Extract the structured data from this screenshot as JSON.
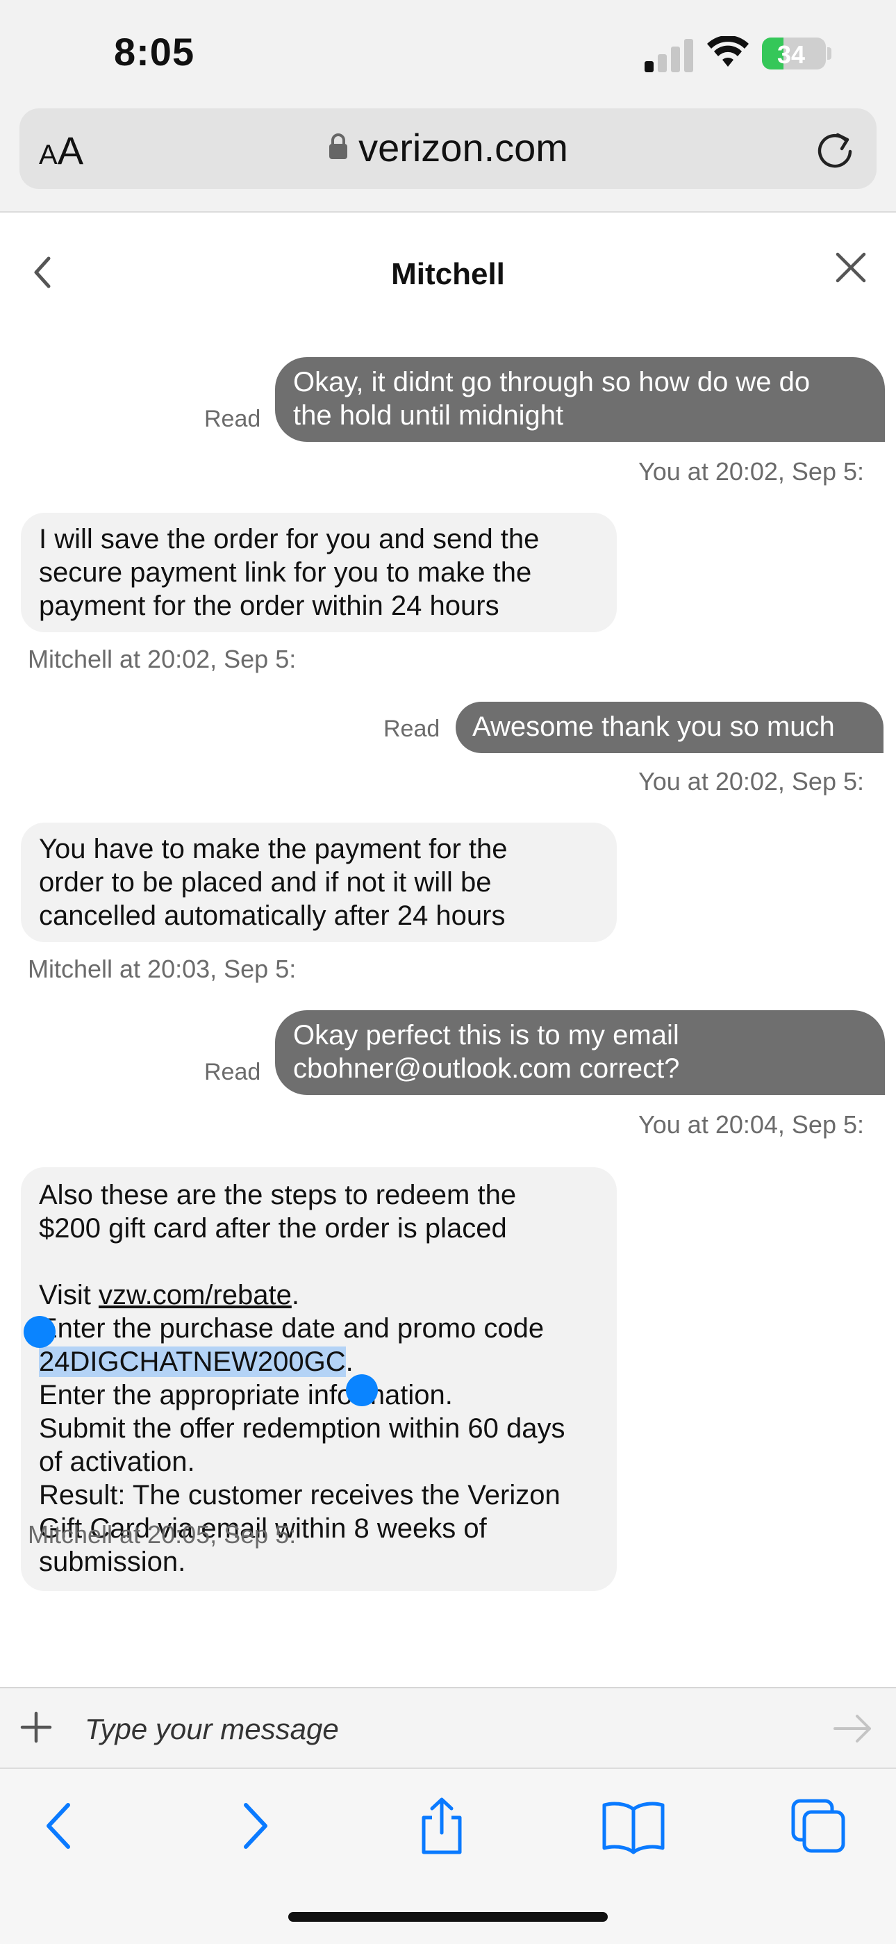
{
  "status_bar": {
    "time": "8:05",
    "battery_percent": "34",
    "battery_level": 0.34,
    "battery_color": "#35c759",
    "signal_bars": 1,
    "icons": [
      "signal-icon",
      "wifi-icon",
      "battery-charging-icon"
    ]
  },
  "url_bar": {
    "reader_label_small": "A",
    "reader_label_large": "A",
    "domain": "verizon.com",
    "icons": [
      "lock-icon",
      "reload-icon"
    ]
  },
  "chat": {
    "title": "Mitchell",
    "icons": [
      "back-icon",
      "close-icon"
    ],
    "messages": [
      {
        "from": "You",
        "text_lines": [
          "Okay, it didnt go through so how do we do",
          "the hold until midnight"
        ],
        "read": "Read",
        "meta": "You at 20:02, Sep 5:"
      },
      {
        "from": "Mitchell",
        "text_lines": [
          "I will save the order for you and send the",
          "secure payment link for you to make the",
          "payment for the order within 24 hours"
        ],
        "meta": "Mitchell at 20:02, Sep 5:"
      },
      {
        "from": "You",
        "text_lines": [
          "Awesome thank you so much"
        ],
        "read": "Read",
        "meta": "You at 20:02, Sep 5:"
      },
      {
        "from": "Mitchell",
        "text_lines": [
          "You have to make the payment for the",
          "order to be placed and if not it will be",
          "cancelled automatically after 24 hours"
        ],
        "meta": "Mitchell at 20:03, Sep 5:"
      },
      {
        "from": "You",
        "text_lines": [
          "Okay perfect this is to my email",
          "cbohner@outlook.com correct?"
        ],
        "read": "Read",
        "meta": "You at 20:04, Sep 5:"
      },
      {
        "from": "Mitchell",
        "rebate": {
          "intro_1": "Also these are the steps to redeem the",
          "intro_2": "$200 gift card after the order is placed",
          "visit_prefix": "Visit ",
          "link": "vzw.com/rebate",
          "visit_suffix": ".",
          "step_1": "Enter the purchase date and promo code",
          "promo_code": "24DIGCHATNEW200GC",
          "promo_suffix": ".",
          "step_2": "Enter the appropriate information.",
          "step_3a": "Submit the offer redemption within 60 days",
          "step_3b": "of activation.",
          "step_4a": "Result: The customer receives the Verizon",
          "step_4b": "Gift Card via email within 8 weeks of",
          "step_4c": "submission."
        },
        "meta": "Mitchell at 20:05, Sep 5:"
      }
    ],
    "selection_color": "#b4d3f6",
    "outgoing_color": "#6f6f6f",
    "incoming_color": "#f2f2f2"
  },
  "composer": {
    "placeholder": "Type your message",
    "icons": [
      "plus-icon",
      "send-arrow-icon"
    ]
  },
  "toolbar": {
    "icons": [
      "back-arrow-icon",
      "forward-arrow-icon",
      "share-icon",
      "bookmarks-icon",
      "tabs-icon"
    ],
    "accent": "#0a7aff"
  }
}
